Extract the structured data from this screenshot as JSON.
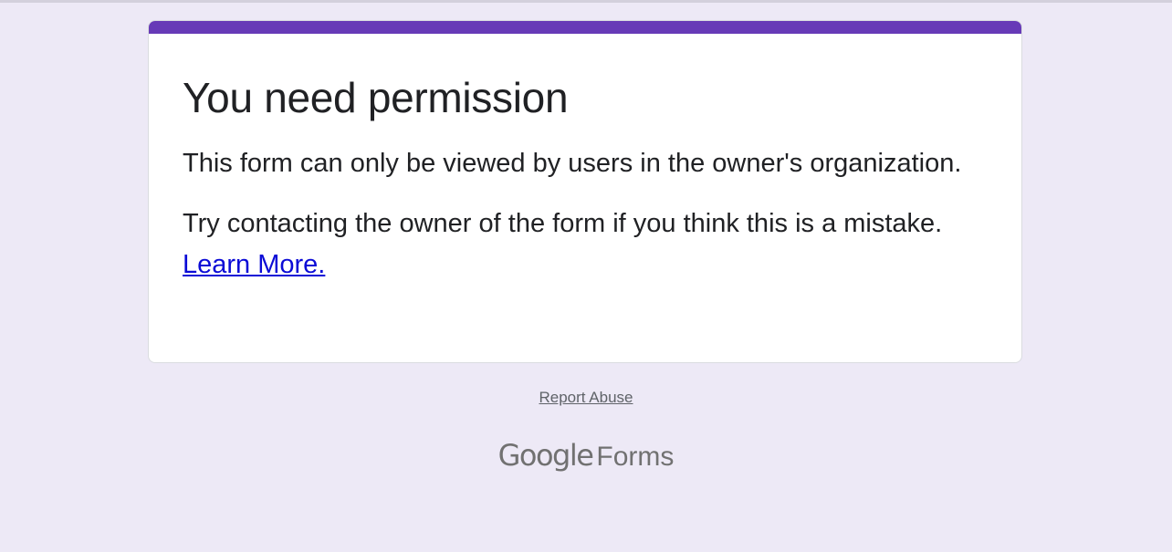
{
  "card": {
    "heading": "You need permission",
    "message": "This form can only be viewed by users in the owner's organization.",
    "hint": "Try contacting the owner of the form if you think this is a mistake.",
    "learn_more_label": "Learn More."
  },
  "footer": {
    "report_abuse_label": "Report Abuse",
    "brand_google": "Google",
    "brand_forms": "Forms"
  },
  "colors": {
    "background": "#ede9f6",
    "accent": "#673ab7",
    "card": "#ffffff",
    "link": "#0b0bd6",
    "text": "#202124",
    "muted": "#5f6368"
  }
}
